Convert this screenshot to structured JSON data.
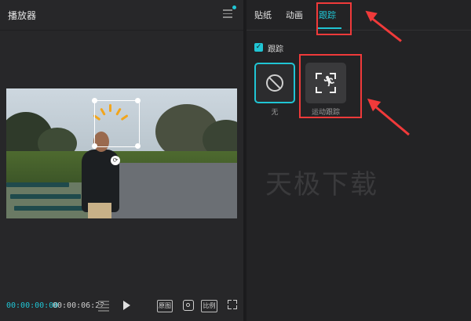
{
  "player": {
    "title": "播放器",
    "time_current": "00:00:00:00",
    "time_total": "00:00:06:22",
    "btn_original": "原图",
    "btn_ratio": "比例"
  },
  "props": {
    "tabs": [
      {
        "label": "贴纸",
        "active": false
      },
      {
        "label": "动画",
        "active": false
      },
      {
        "label": "跟踪",
        "active": true
      }
    ],
    "checkbox_label": "跟踪",
    "options": [
      {
        "label": "无",
        "selected": true,
        "icon": "none-icon"
      },
      {
        "label": "运动跟踪",
        "selected": false,
        "icon": "motion-tracking-icon"
      }
    ]
  },
  "watermark": "天极下载",
  "colors": {
    "accent": "#20c5d4",
    "annotation_red": "#f03a3a",
    "sparkle": "#f2a51c"
  }
}
